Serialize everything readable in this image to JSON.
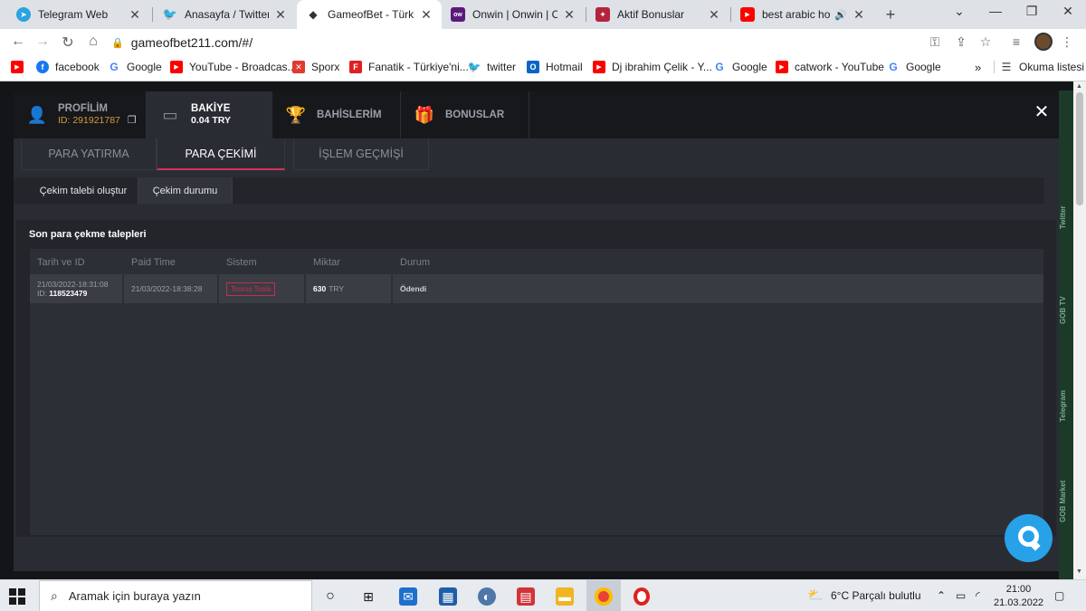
{
  "browser": {
    "tabs": [
      {
        "title": "Telegram Web",
        "icon": "telegram-icon",
        "color": "#2aa3e0"
      },
      {
        "title": "Anasayfa / Twitter",
        "icon": "twitter-icon",
        "color": "#1d9bf0"
      },
      {
        "title": "GameofBet - Türkiye'nin",
        "icon": "gameofbet-icon",
        "color": "#333333",
        "active": true
      },
      {
        "title": "Onwin | Onwin | Onwin",
        "icon": "onwin-icon",
        "color": "#5a1a7a"
      },
      {
        "title": "Aktif Bonuslar",
        "icon": "bonus-icon",
        "color": "#b3243c"
      },
      {
        "title": "best arabic house",
        "icon": "youtube-icon",
        "color": "#ff0000"
      }
    ],
    "url": "gameofbet211.com/#/",
    "bookmarks": [
      {
        "label": "facebook",
        "icon": "facebook-icon",
        "color": "#1877f2"
      },
      {
        "label": "Google",
        "icon": "google-icon",
        "color": "#4285f4"
      },
      {
        "label": "YouTube - Broadcas...",
        "icon": "youtube-icon",
        "color": "#ff0000"
      },
      {
        "label": "Sporx",
        "icon": "sporx-icon",
        "color": "#e23a2e"
      },
      {
        "label": "Fanatik - Türkiye'ni...",
        "icon": "fanatik-icon",
        "color": "#e02020"
      },
      {
        "label": "twitter",
        "icon": "twitter-icon",
        "color": "#1d9bf0"
      },
      {
        "label": "Hotmail",
        "icon": "outlook-icon",
        "color": "#0a64c8"
      },
      {
        "label": "Dj ibrahim Çelik - Y...",
        "icon": "youtube-icon",
        "color": "#ff0000"
      },
      {
        "label": "Google",
        "icon": "google-icon",
        "color": "#4285f4"
      },
      {
        "label": "catwork - YouTube",
        "icon": "youtube-icon",
        "color": "#ff0000"
      },
      {
        "label": "Google",
        "icon": "google-icon",
        "color": "#4285f4"
      }
    ],
    "more_bookmarks": "»",
    "reading_list": "Okuma listesi"
  },
  "account": {
    "profile_label": "PROFİLİM",
    "profile_id": "ID: 291921787",
    "balance_label": "BAKİYE",
    "balance_value": "0.04 TRY",
    "bets_label": "BAHİSLERİM",
    "bonuses_label": "BONUSLAR",
    "close": "✕"
  },
  "subtabs": [
    "PARA YATIRMA",
    "PARA ÇEKİMİ",
    "İŞLEM GEÇMİŞİ"
  ],
  "withdraw_buttons": [
    "Çekim talebi oluştur",
    "Çekim durumu"
  ],
  "section_title": "Son para çekme talepleri",
  "table": {
    "headers": [
      "Tarih ve ID",
      "Paid Time",
      "Sistem",
      "Miktar",
      "Durum"
    ],
    "rows": [
      {
        "date": "21/03/2022-18:31:08",
        "id_prefix": "ID:",
        "id": "118523479",
        "paid_time": "21/03/2022-18:38:28",
        "system": "Tosros Tosla",
        "amount": "630",
        "currency": "TRY",
        "status": "Ödendi"
      }
    ]
  },
  "side_labels": [
    "Twitter",
    "GOB TV",
    "Telegram",
    "GOB Market"
  ],
  "taskbar": {
    "search_placeholder": "Aramak için buraya yazın",
    "weather": "6°C  Parçalı bulutlu",
    "time": "21:00",
    "date": "21.03.2022"
  },
  "colors": {
    "accent": "#d5315c",
    "success": "#35b06a",
    "balance_id": "#d79a3c",
    "chat": "#27a2e8"
  }
}
